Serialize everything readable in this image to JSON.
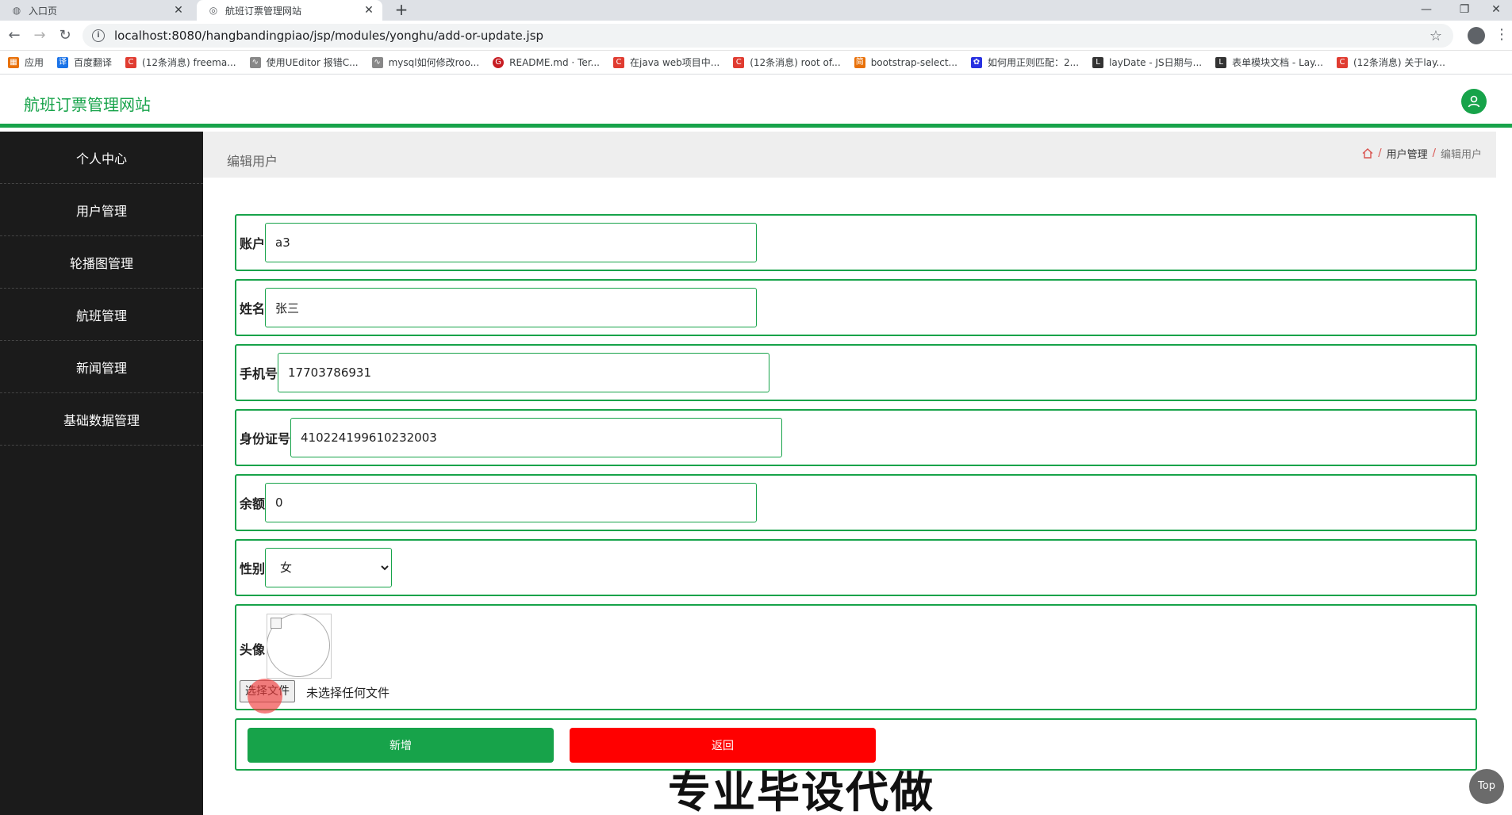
{
  "browser": {
    "tabs": [
      {
        "title": "入口页",
        "icon": "globe-icon"
      },
      {
        "title": "航班订票管理网站",
        "icon": "site-icon"
      }
    ],
    "url": "localhost:8080/hangbandingpiao/jsp/modules/yonghu/add-or-update.jsp",
    "bookmarks": [
      "应用",
      "百度翻译",
      "(12条消息) freema...",
      "使用UEditor 报错C...",
      "mysql如何修改roo...",
      "README.md · Ter...",
      "在java web项目中...",
      "(12条消息) root of...",
      "bootstrap-select...",
      "如何用正则匹配：2...",
      "layDate - JS日期与...",
      "表单模块文档 - Lay...",
      "(12条消息) 关于lay..."
    ]
  },
  "header": {
    "site_title": "航班订票管理网站"
  },
  "sidebar": {
    "items": [
      "个人中心",
      "用户管理",
      "轮播图管理",
      "航班管理",
      "新闻管理",
      "基础数据管理"
    ]
  },
  "page": {
    "title": "编辑用户",
    "breadcrumb": {
      "parent": "用户管理",
      "current": "编辑用户"
    }
  },
  "form": {
    "account": {
      "label": "账户",
      "value": "a3"
    },
    "name": {
      "label": "姓名",
      "value": "张三"
    },
    "phone": {
      "label": "手机号",
      "value": "17703786931"
    },
    "idcard": {
      "label": "身份证号",
      "value": "410224199610232003"
    },
    "balance": {
      "label": "余额",
      "value": "0"
    },
    "gender": {
      "label": "性别",
      "value": "女"
    },
    "avatar": {
      "label": "头像",
      "button": "选择文件",
      "status": "未选择任何文件"
    },
    "add_button": "新增",
    "back_button": "返回"
  },
  "overlay": {
    "watermark": "专业毕设代做",
    "top_button": "Top"
  },
  "colors": {
    "accent": "#17a34a",
    "danger": "#ff0000",
    "sidebar_bg": "#1b1b1b"
  }
}
